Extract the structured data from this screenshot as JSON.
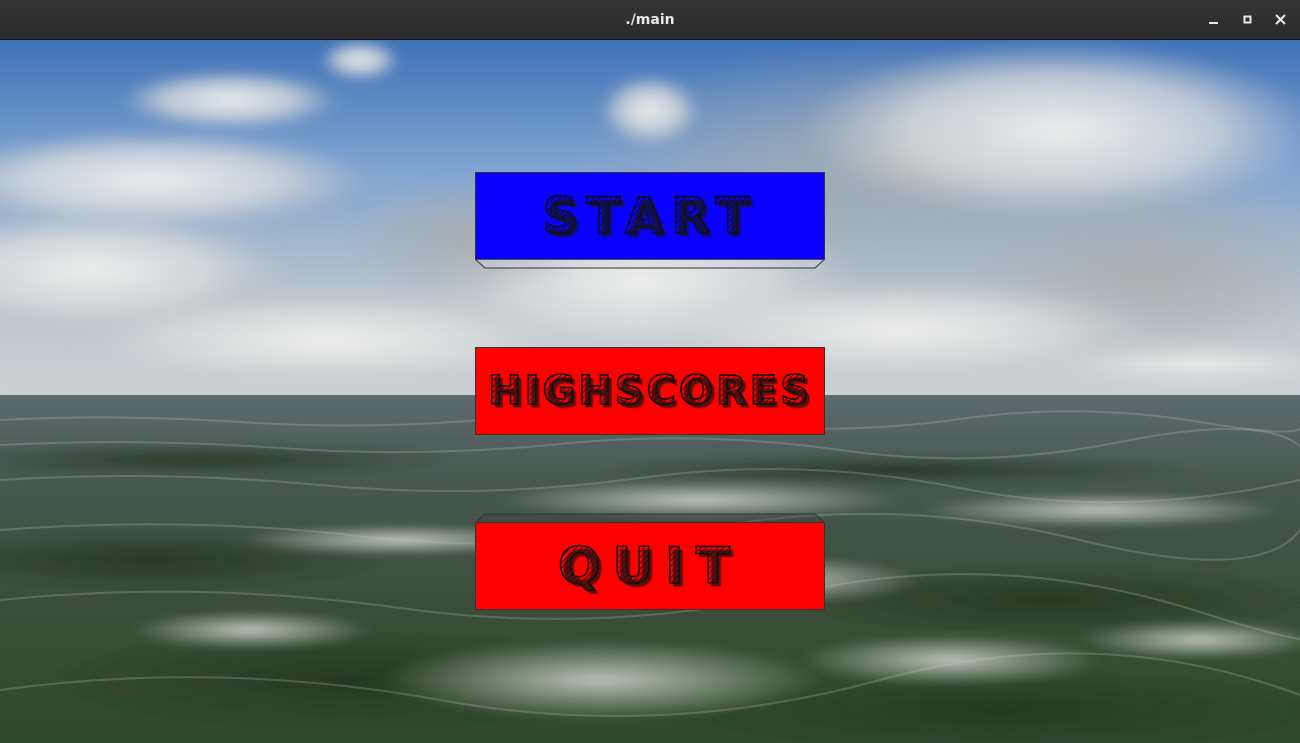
{
  "window": {
    "title": "./main",
    "controls": [
      "minimize-icon",
      "maximize-icon",
      "close-icon"
    ]
  },
  "menu": {
    "start_label": "START",
    "highscores_label": "HIGHSCORES",
    "quit_label": "QUIT"
  },
  "colors": {
    "start_button": "#0a00ff",
    "highscores_button": "#ff0000",
    "quit_button": "#ff0000",
    "titlebar": "#2f2f2f",
    "title_text": "#e8e8e8"
  },
  "background": {
    "description_icon": "ocean-sky-scene"
  }
}
